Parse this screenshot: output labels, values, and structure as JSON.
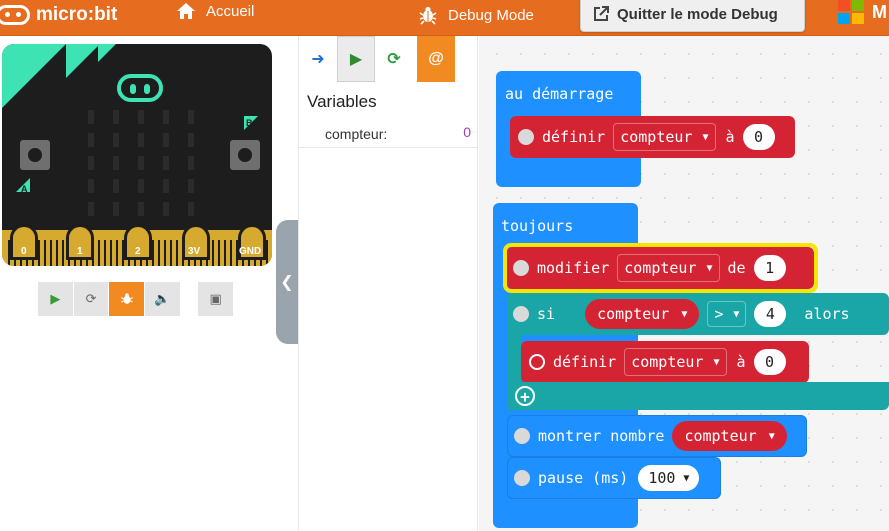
{
  "header": {
    "brand": "micro:bit",
    "home_label": "Accueil",
    "debug_label": "Debug Mode",
    "quit_label": "Quitter le mode Debug",
    "ms_text": "M"
  },
  "simulator": {
    "pins": [
      "0",
      "1",
      "2",
      "3V",
      "GND"
    ],
    "button_a": "A",
    "button_b": "B",
    "toolbar": [
      "play-icon",
      "restart-icon",
      "debug-icon",
      "sound-icon",
      "fullscreen-icon"
    ]
  },
  "debugger": {
    "variables_title": "Variables",
    "variables": [
      {
        "name": "compteur:",
        "value": "0"
      }
    ]
  },
  "workspace": {
    "on_start": {
      "label": "au démarrage",
      "set": {
        "verb": "définir",
        "var": "compteur",
        "to": "à",
        "value": "0"
      }
    },
    "forever": {
      "label": "toujours",
      "change": {
        "verb": "modifier",
        "var": "compteur",
        "by": "de",
        "value": "1"
      },
      "if": {
        "kw": "si",
        "var": "compteur",
        "op": ">",
        "value": "4",
        "then": "alors"
      },
      "inner_set": {
        "verb": "définir",
        "var": "compteur",
        "to": "à",
        "value": "0"
      },
      "show": {
        "verb": "montrer nombre",
        "var": "compteur"
      },
      "pause": {
        "verb": "pause (ms)",
        "value": "100"
      }
    }
  },
  "colors": {
    "header": "#e66c1f",
    "variable_block": "#d42434",
    "logic_block": "#1aa6a6",
    "basic_block": "#1e90ff",
    "highlight": "#f6e600"
  }
}
